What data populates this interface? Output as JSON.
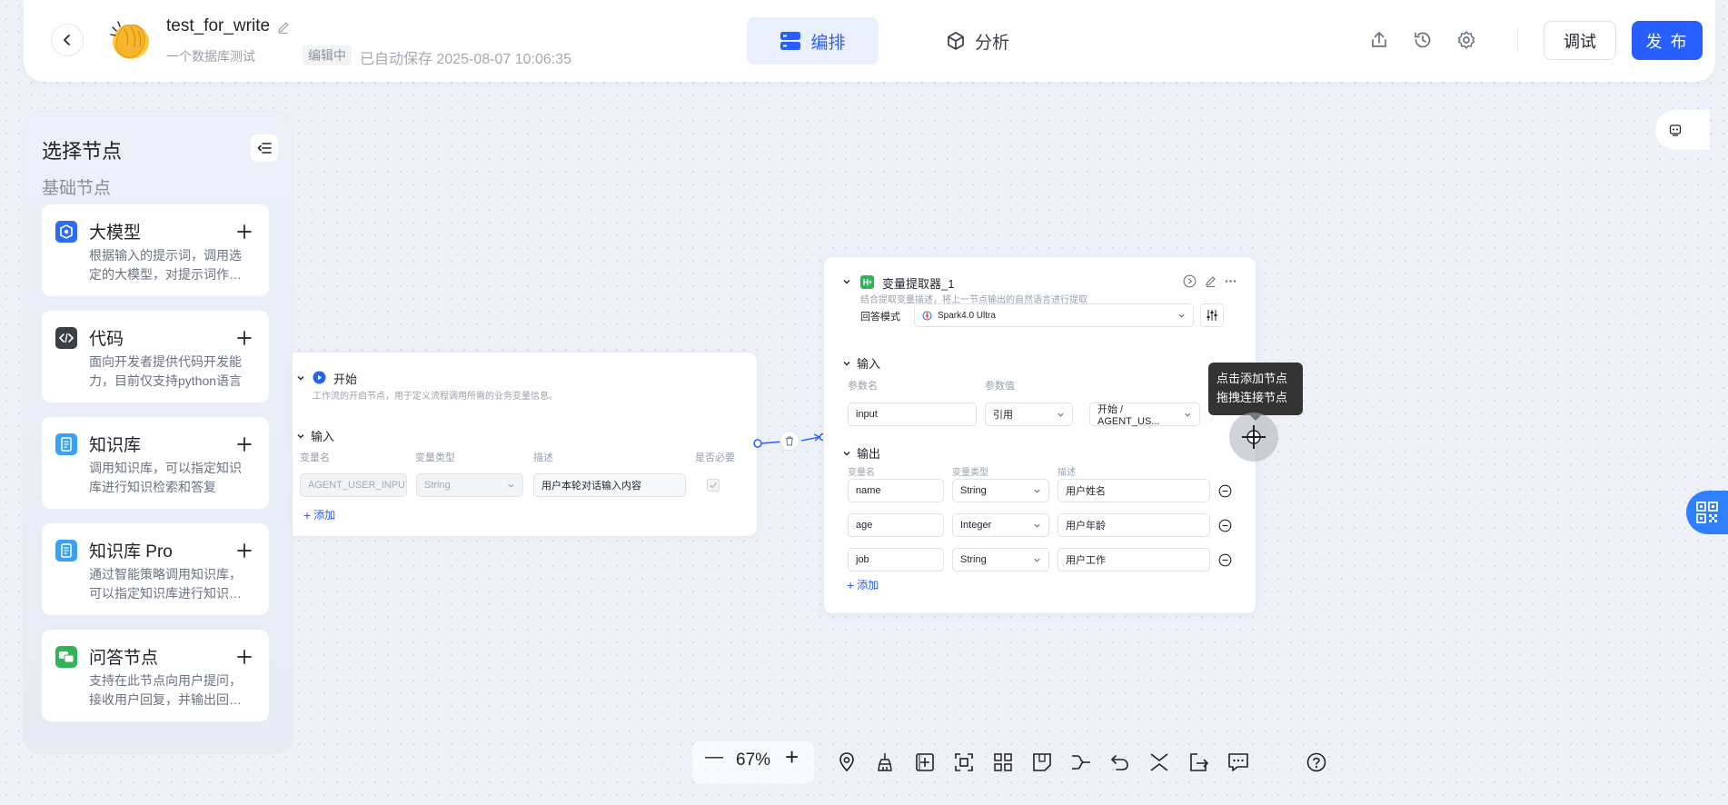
{
  "header": {
    "title": "test_for_write",
    "description": "一个数据库测试",
    "status": "编辑中",
    "autosave": "已自动保存 2025-08-07 10:06:35",
    "tabs": [
      {
        "label": "编排",
        "active": true
      },
      {
        "label": "分析",
        "active": false
      }
    ],
    "debug_label": "调试",
    "publish_label": "发 布",
    "icons": [
      "share-icon",
      "history-icon",
      "gear-icon"
    ]
  },
  "sidebar": {
    "title": "选择节点",
    "section": "基础节点",
    "nodes": [
      {
        "name": "大模型",
        "desc": "根据输入的提示词，调用选定的大模型，对提示词作出回答",
        "icon": "llm-icon",
        "color": "#2d6bf5"
      },
      {
        "name": "代码",
        "desc": "面向开发者提供代码开发能力，目前仅支持python语言",
        "icon": "code-icon",
        "color": "#3b3f46"
      },
      {
        "name": "知识库",
        "desc": "调用知识库，可以指定知识库进行知识检索和答复",
        "icon": "knowledge-icon",
        "color": "#3aa1f4"
      },
      {
        "name": "知识库 Pro",
        "desc": "通过智能策略调用知识库，可以指定知识库进行知识检索",
        "icon": "knowledge-pro-icon",
        "color": "#3aa1f4"
      },
      {
        "name": "问答节点",
        "desc": "支持在此节点向用户提问，接收用户回复，并输出回复内容",
        "icon": "qa-icon",
        "color": "#33b45a"
      }
    ]
  },
  "start_node": {
    "title": "开始",
    "desc": "工作流的开启节点，用于定义流程调用所需的业务变量信息。",
    "input_label": "输入",
    "col_name": "变量名",
    "col_type": "变量类型",
    "col_desc": "描述",
    "col_required": "是否必要",
    "row": {
      "name": "AGENT_USER_INPUT",
      "type": "String",
      "desc": "用户本轮对话输入内容"
    },
    "add_label": "添加"
  },
  "extractor_node": {
    "title": "变量提取器_1",
    "desc": "结合提取变量描述，将上一节点输出的自然语言进行提取",
    "mode_label": "回答模式",
    "model": "Spark4.0 Ultra",
    "input_label": "输入",
    "param_name_col": "参数名",
    "param_value_col": "参数值",
    "input_row": {
      "name": "input",
      "ref": "引用",
      "value": "开始 / AGENT_US..."
    },
    "output_label": "输出",
    "out_col_name": "变量名",
    "out_col_type": "变量类型",
    "out_col_desc": "描述",
    "outputs": [
      {
        "name": "name",
        "type": "String",
        "desc": "用户姓名"
      },
      {
        "name": "age",
        "type": "Integer",
        "desc": "用户年龄"
      },
      {
        "name": "job",
        "type": "String",
        "desc": "用户工作"
      }
    ],
    "add_label": "添加"
  },
  "tooltip": {
    "line1": "点击添加节点",
    "line2": "拖拽连接节点"
  },
  "toolbar": {
    "zoom": "67%",
    "minus": "—",
    "plus": "+",
    "tools": [
      "locate-icon",
      "clean-icon",
      "add-frame-icon",
      "fit-view-icon",
      "layout-icon",
      "note-icon",
      "connector-icon",
      "undo-icon",
      "collapse-icon",
      "export-icon",
      "comment-icon",
      "help-icon"
    ]
  },
  "colors": {
    "accent": "#275eff",
    "success": "#33b45a"
  }
}
